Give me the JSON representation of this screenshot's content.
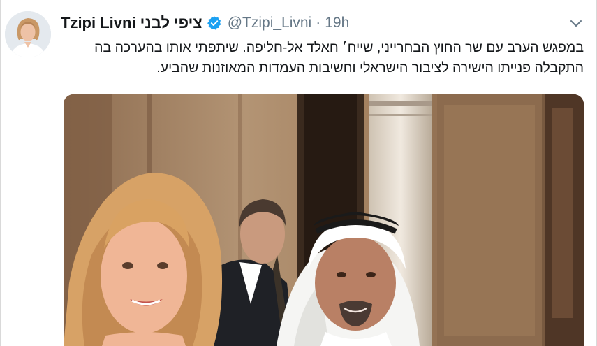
{
  "author": {
    "display_name": "Tzipi Livni ציפי לבני",
    "handle": "@Tzipi_Livni",
    "separator": "·",
    "time": "19h",
    "verified": true,
    "avatar_icon": "profile-photo"
  },
  "tweet": {
    "lines": [
      "במפגש הערב עם שר החוץ הבחרייני, שייח׳ חאלד אל-חליפה. שיתפתי אותו בהערכה בה",
      "התקבלה פנייתו הישירה לציבור הישראלי וחשיבות העמדות המאוזנות שהביע."
    ]
  },
  "icons": {
    "verified": "verified-badge-icon",
    "menu": "chevron-down-icon"
  },
  "colors": {
    "accent": "#1da1f2",
    "text": "#14171a",
    "muted": "#657786"
  }
}
